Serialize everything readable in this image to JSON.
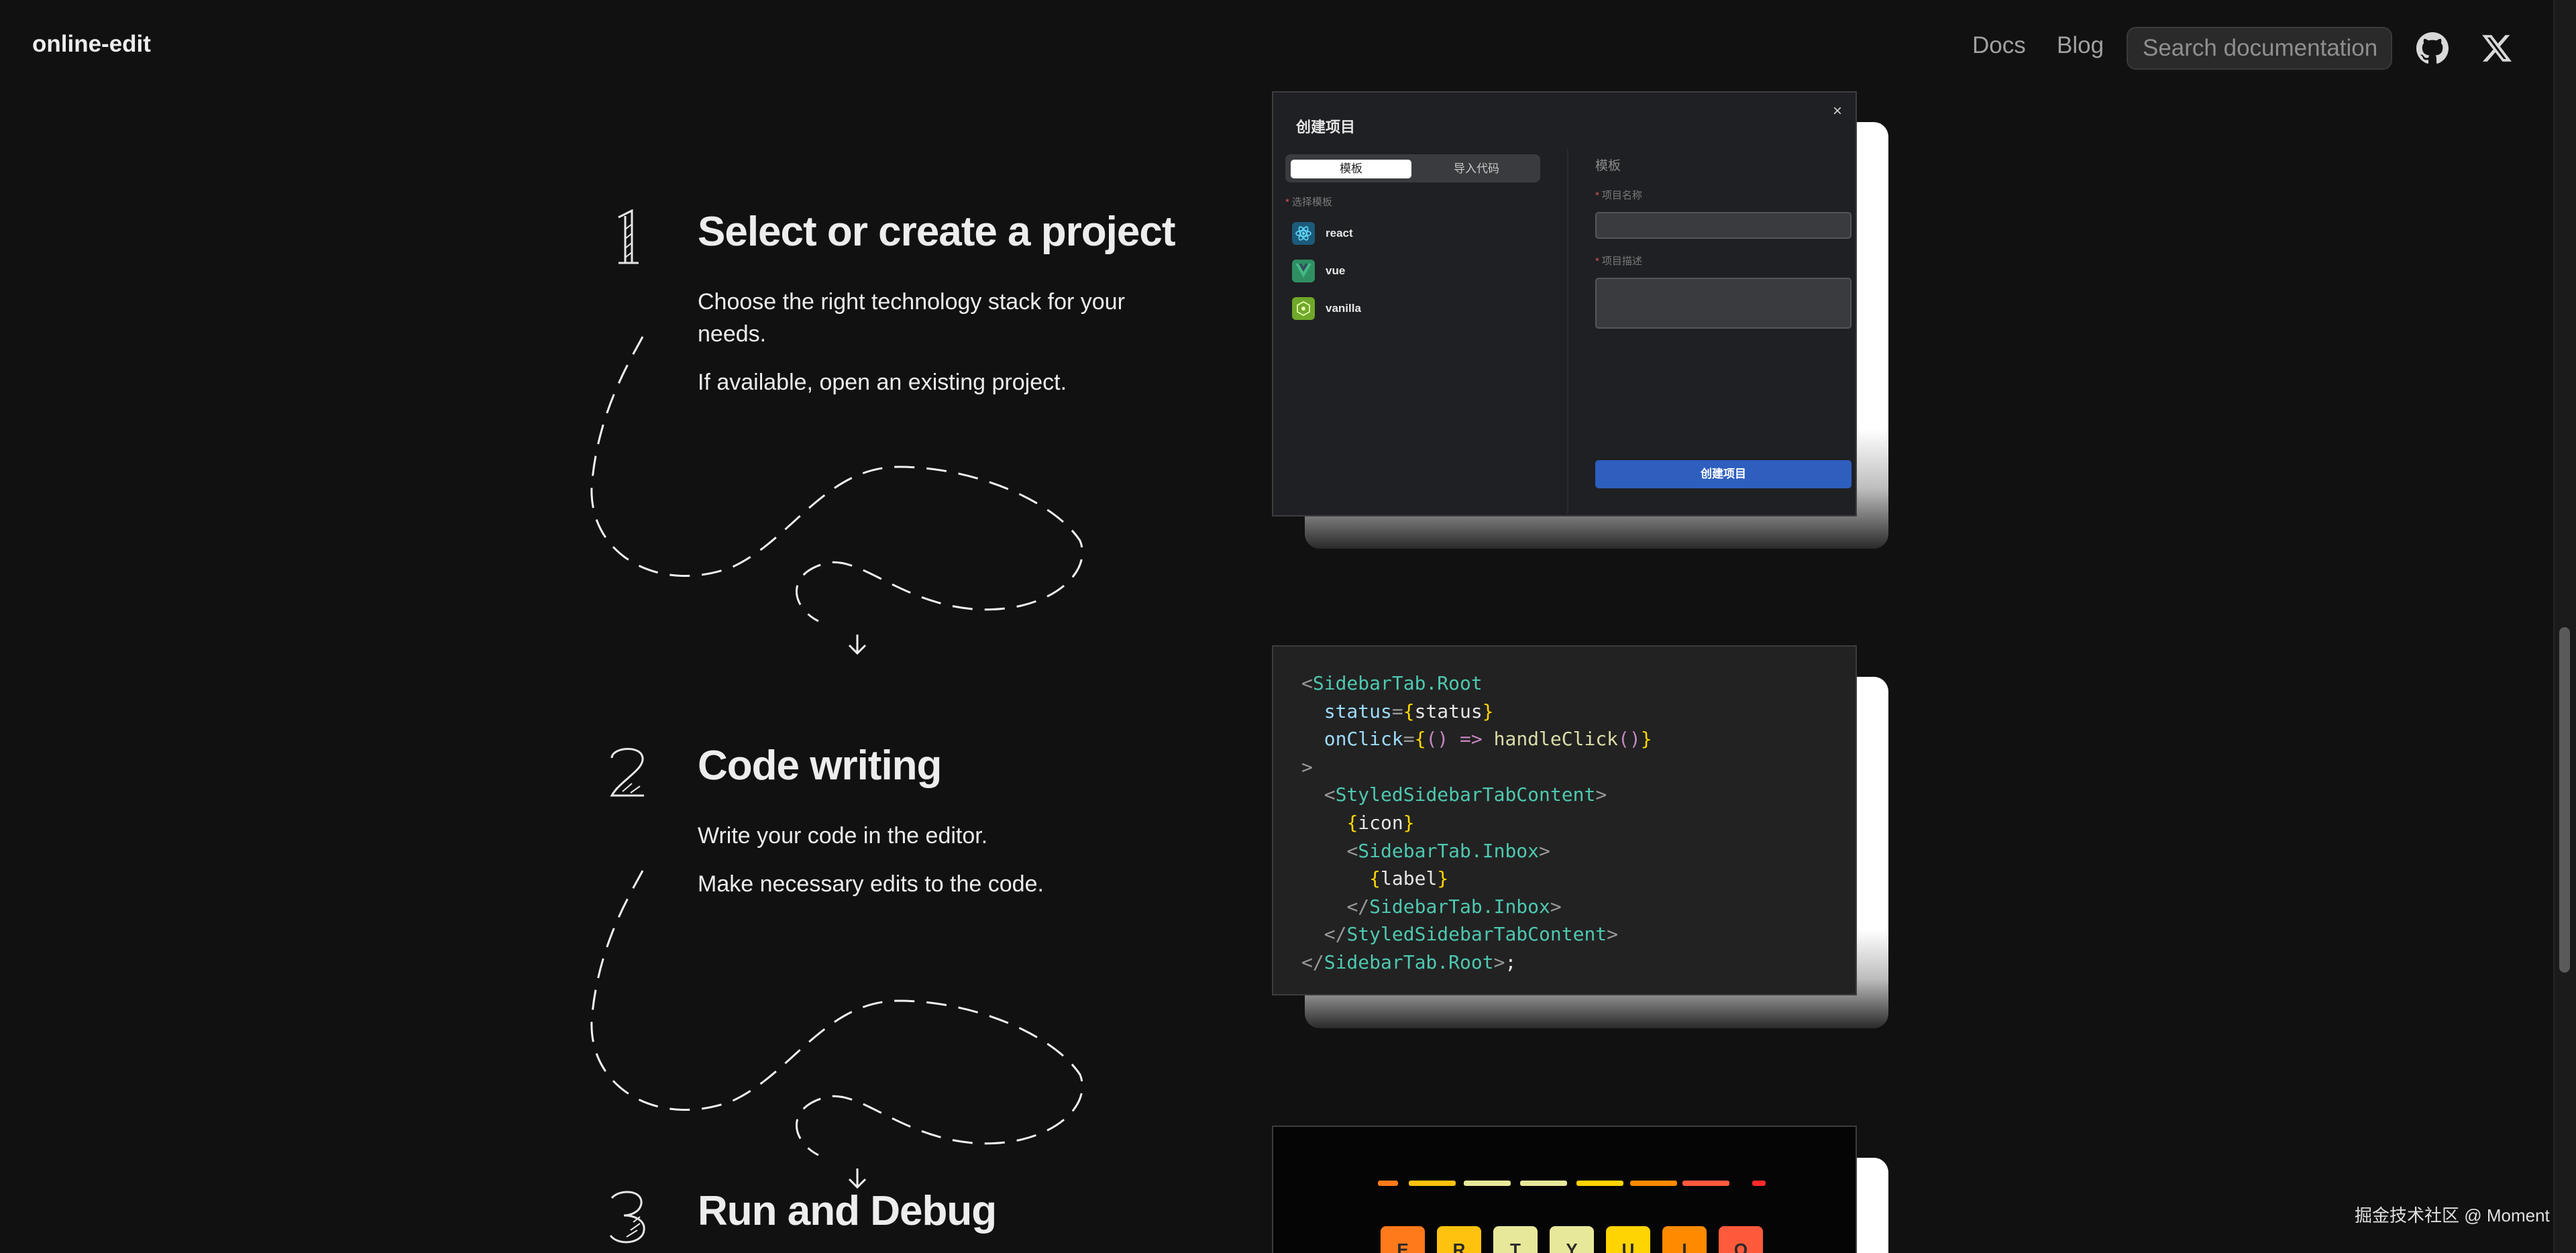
{
  "header": {
    "brand": "online-edit",
    "nav": [
      "Docs",
      "Blog"
    ],
    "search_placeholder": "Search documentation",
    "icons": [
      "github-icon",
      "x-icon"
    ]
  },
  "steps": [
    {
      "number": "1",
      "title": "Select or create a project",
      "lines": [
        "Choose the right technology stack for your needs.",
        "If available, open an existing project."
      ]
    },
    {
      "number": "2",
      "title": "Code writing",
      "lines": [
        "Write your code in the editor.",
        "Make necessary edits to the code."
      ]
    },
    {
      "number": "3",
      "title": "Run and Debug",
      "lines": []
    }
  ],
  "create_dialog": {
    "title": "创建项目",
    "close": "×",
    "tabs": [
      "模板",
      "导入代码"
    ],
    "select_template_label": "选择模板",
    "templates": [
      {
        "name": "react",
        "icon": "react-icon",
        "color": "#61dafb"
      },
      {
        "name": "vue",
        "icon": "vue-icon",
        "color": "#42b883"
      },
      {
        "name": "vanilla",
        "icon": "vanilla-icon",
        "color": "#9bd53a"
      }
    ],
    "right_heading": "模板",
    "project_name_label": "项目名称",
    "project_desc_label": "项目描述",
    "submit": "创建项目"
  },
  "code_lines": [
    "<SidebarTab.Root",
    "  status={status}",
    "  onClick={() => handleClick()}",
    ">",
    "  <StyledSidebarTabContent>",
    "    {icon}",
    "    <SidebarTab.Inbox>",
    "      {label}",
    "    </SidebarTab.Inbox>",
    "  </StyledSidebarTabContent>",
    "</SidebarTab.Root>;"
  ],
  "game": {
    "keys": [
      "E",
      "R",
      "T",
      "Y",
      "U",
      "I",
      "O"
    ],
    "key_colors": [
      "#ff7a1a",
      "#ffc20e",
      "#e8e89a",
      "#e8e89a",
      "#ffd400",
      "#ff8a00",
      "#ff5a3c"
    ],
    "bar_colors": [
      "#ff7a1a",
      "#ffc20e",
      "#e8e89a",
      "#e8e89a",
      "#ffd400",
      "#ff8a00",
      "#ff5a3c",
      "#ff2a2a"
    ]
  },
  "watermark": "掘金技术社区 @ Moment"
}
